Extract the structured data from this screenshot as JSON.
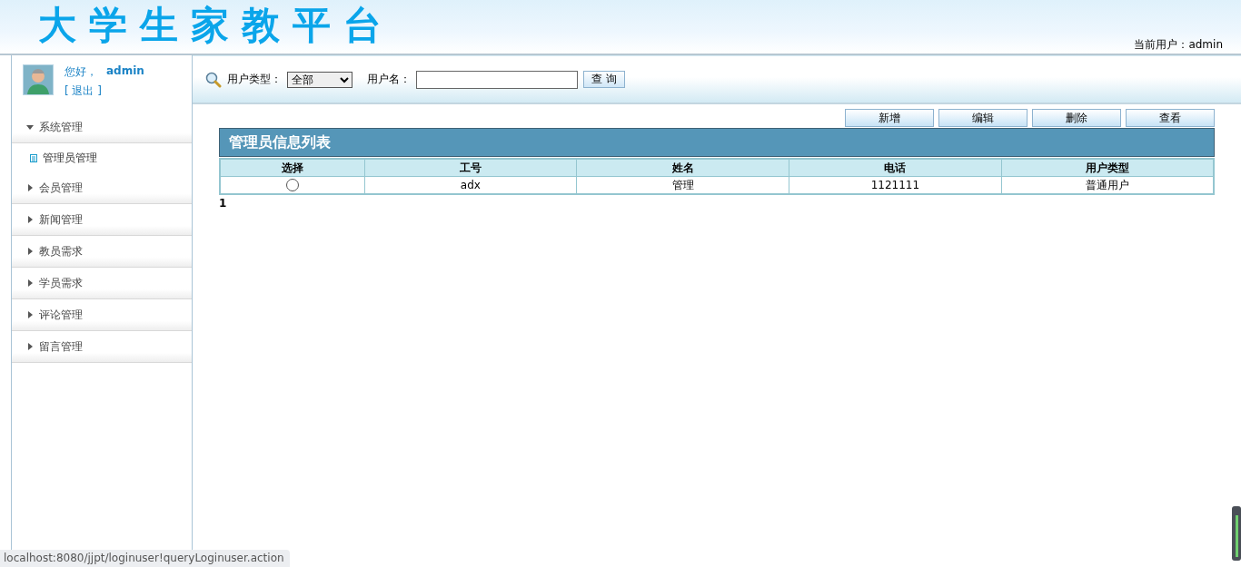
{
  "header": {
    "logo": "大学生家教平台",
    "current_user": "当前用户：admin"
  },
  "user_panel": {
    "greeting": "您好，",
    "username": "admin",
    "logout": "[ 退出 ]"
  },
  "menu": [
    {
      "label": "系统管理",
      "expanded": true,
      "children": [
        {
          "label": "管理员管理"
        }
      ]
    },
    {
      "label": "会员管理",
      "expanded": false
    },
    {
      "label": "新闻管理",
      "expanded": false
    },
    {
      "label": "教员需求",
      "expanded": false
    },
    {
      "label": "学员需求",
      "expanded": false
    },
    {
      "label": "评论管理",
      "expanded": false
    },
    {
      "label": "留言管理",
      "expanded": false
    }
  ],
  "search": {
    "type_label": "用户类型：",
    "type_value": "全部",
    "name_label": "用户名：",
    "button": "查 询"
  },
  "actions": [
    "新增",
    "编辑",
    "删除",
    "查看"
  ],
  "table": {
    "title": "管理员信息列表",
    "columns": [
      "选择",
      "工号",
      "姓名",
      "电话",
      "用户类型"
    ],
    "rows": [
      {
        "selected": false,
        "cells": [
          "",
          "adx",
          "管理",
          "1121111",
          "普通用户"
        ]
      }
    ]
  },
  "pagination": "1",
  "status_bar": "localhost:8080/jjpt/loginuser!queryLoginuser.action"
}
